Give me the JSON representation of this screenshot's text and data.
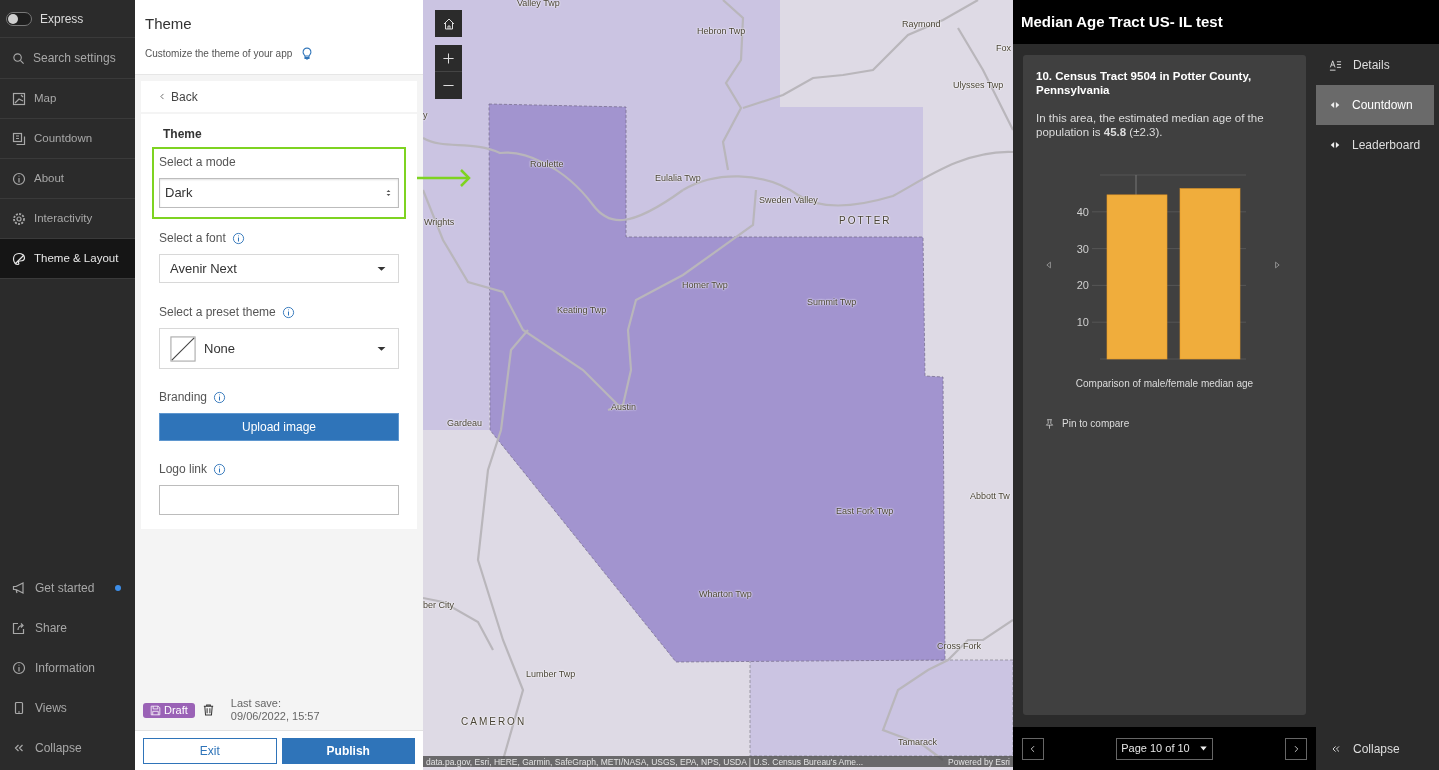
{
  "nav": {
    "toggle": {
      "label": "Express",
      "on": false
    },
    "search": {
      "placeholder": "Search settings"
    },
    "items": [
      {
        "label": "Map",
        "selected": false
      },
      {
        "label": "Countdown",
        "selected": false
      },
      {
        "label": "About",
        "selected": false
      },
      {
        "label": "Interactivity",
        "selected": false
      },
      {
        "label": "Theme & Layout",
        "selected": true
      }
    ],
    "bottom_items": [
      {
        "label": "Get started",
        "notification": true
      },
      {
        "label": "Share",
        "notification": false
      },
      {
        "label": "Information",
        "notification": false
      },
      {
        "label": "Views",
        "notification": false
      },
      {
        "label": "Collapse",
        "notification": false
      }
    ]
  },
  "settings": {
    "title": "Theme",
    "subtitle": "Customize the theme of your app",
    "back": "Back",
    "heading": "Theme",
    "fields": [
      {
        "kind": "select",
        "label": "Select a mode",
        "value": "Dark",
        "info": false,
        "highlighted": true
      },
      {
        "kind": "dropdown",
        "label": "Select a font",
        "value": "Avenir Next",
        "info": true,
        "highlighted": false
      },
      {
        "kind": "preset",
        "label": "Select a preset theme",
        "value": "None",
        "info": true,
        "highlighted": false
      },
      {
        "kind": "button",
        "label": "Branding",
        "value": "Upload image",
        "info": true,
        "highlighted": false
      },
      {
        "kind": "input",
        "label": "Logo link",
        "info": true,
        "highlighted": false
      }
    ],
    "footer": {
      "badge": "Draft",
      "last_save_label": "Last save:",
      "last_save": "09/06/2022, 15:57",
      "buttons": [
        {
          "label": "Exit",
          "kind": "secondary"
        },
        {
          "label": "Publish",
          "kind": "primary"
        }
      ]
    }
  },
  "map": {
    "labels": [
      {
        "text": "Valley Twp",
        "kind": "place"
      },
      {
        "text": "Hebron Twp",
        "kind": "place"
      },
      {
        "text": "Raymond",
        "kind": "place"
      },
      {
        "text": "Fox",
        "kind": "place"
      },
      {
        "text": "Ulysses Twp",
        "kind": "place"
      },
      {
        "text": "y",
        "kind": "place"
      },
      {
        "text": "Roulette",
        "kind": "place"
      },
      {
        "text": "Eulalia Twp",
        "kind": "place"
      },
      {
        "text": "Sweden Valley",
        "kind": "place"
      },
      {
        "text": "POTTER",
        "kind": "county"
      },
      {
        "text": "Wrights",
        "kind": "place"
      },
      {
        "text": "Homer Twp",
        "kind": "place"
      },
      {
        "text": "Keating Twp",
        "kind": "place"
      },
      {
        "text": "Summit Twp",
        "kind": "place"
      },
      {
        "text": "Austin",
        "kind": "place"
      },
      {
        "text": "Gardeau",
        "kind": "place"
      },
      {
        "text": "East Fork Twp",
        "kind": "place"
      },
      {
        "text": "Abbott Tw",
        "kind": "place"
      },
      {
        "text": "Wharton Twp",
        "kind": "place"
      },
      {
        "text": "Cross Fork",
        "kind": "place"
      },
      {
        "text": "ber City",
        "kind": "place"
      },
      {
        "text": "Lumber Twp",
        "kind": "place"
      },
      {
        "text": "CAMERON",
        "kind": "county"
      },
      {
        "text": "Tamarack",
        "kind": "place"
      }
    ],
    "attribution": "data.pa.gov, Esri, HERE, Garmin, SafeGraph, METI/NASA, USGS, EPA, NPS, USDA | U.S. Census Bureau's Ame...",
    "powered_by": "Powered by Esri"
  },
  "app": {
    "title": "Median Age Tract US- IL test",
    "card": {
      "title": "10. Census Tract 9504 in Potter County, Pennsylvania",
      "description": "In this area, the estimated median age of the population is **45.8** (±2.3).",
      "chart_data": {
        "type": "bar",
        "title": "Comparison of male/female median age",
        "values": [
          44.6,
          46.3
        ],
        "ylim": [
          0,
          50
        ],
        "grid": true,
        "yticks": [
          10,
          20,
          30,
          40
        ]
      },
      "pin": "Pin to compare"
    },
    "pager": {
      "label": "Page 10 of 10"
    },
    "side_nav": [
      {
        "label": "Details",
        "selected": false
      },
      {
        "label": "Countdown",
        "selected": true
      },
      {
        "label": "Leaderboard",
        "selected": false
      }
    ],
    "collapse": "Collapse"
  }
}
